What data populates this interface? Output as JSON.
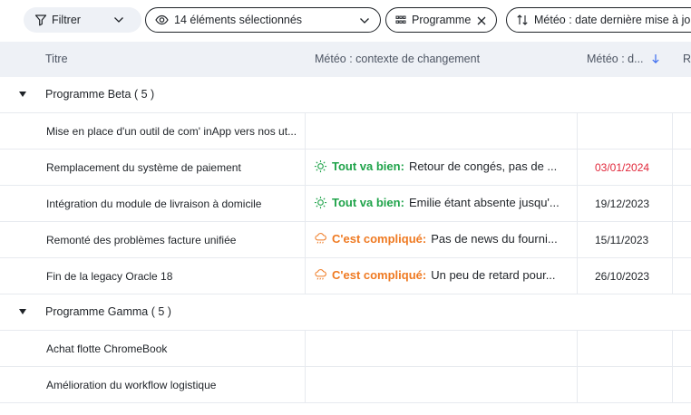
{
  "toolbar": {
    "filter_label": "Filtrer",
    "columns_label": "14 éléments sélectionnés",
    "group_label": "Programme",
    "sort_label": "Météo : date dernière mise à jour"
  },
  "table": {
    "headers": {
      "title": "Titre",
      "context": "Météo : contexte de changement",
      "date": "Météo : d...",
      "extra": "Re"
    }
  },
  "groups": [
    {
      "label": "Programme Beta ( 5 )",
      "rows": [
        {
          "title": "Mise en place d'un outil de com' inApp vers nos ut...",
          "status": "",
          "status_kind": "",
          "detail": "",
          "date": "",
          "date_overdue": false
        },
        {
          "title": "Remplacement du système de paiement",
          "status": "Tout va bien:",
          "status_kind": "good",
          "detail": "Retour de congés, pas de ...",
          "date": "03/01/2024",
          "date_overdue": true
        },
        {
          "title": "Intégration du module de livraison à domicile",
          "status": "Tout va bien:",
          "status_kind": "good",
          "detail": "Emilie étant absente jusqu'...",
          "date": "19/12/2023",
          "date_overdue": false
        },
        {
          "title": "Remonté des problèmes facture unifiée",
          "status": "C'est compliqué:",
          "status_kind": "bad",
          "detail": "Pas de news du fourni...",
          "date": "15/11/2023",
          "date_overdue": false
        },
        {
          "title": "Fin de la legacy Oracle 18",
          "status": "C'est compliqué:",
          "status_kind": "bad",
          "detail": "Un peu de retard pour...",
          "date": "26/10/2023",
          "date_overdue": false
        }
      ]
    },
    {
      "label": "Programme Gamma ( 5 )",
      "rows": [
        {
          "title": "Achat flotte ChromeBook",
          "status": "",
          "status_kind": "",
          "detail": "",
          "date": "",
          "date_overdue": false
        },
        {
          "title": "Amélioration du workflow logistique",
          "status": "",
          "status_kind": "",
          "detail": "",
          "date": "",
          "date_overdue": false
        }
      ]
    }
  ],
  "icons": {
    "filter": "filter-icon",
    "columns": "eye-icon",
    "group": "grid-icon",
    "sort": "sort-arrows-icon",
    "good": "sun-icon",
    "bad": "rain-cloud-icon"
  },
  "colors": {
    "good": "#1fa34a",
    "bad": "#ef7a22",
    "overdue": "#e1283b",
    "header_bg": "#eef1f6",
    "sort_arrow": "#3b6cf0"
  }
}
